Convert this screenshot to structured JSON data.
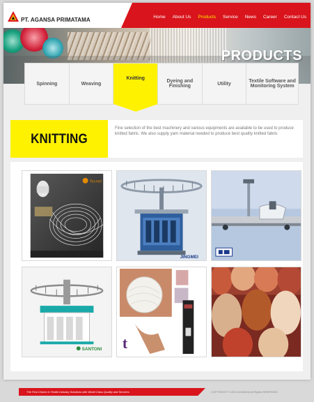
{
  "header": {
    "brand": "PT. AGANSA PRIMATAMA",
    "logo_icon": "triangle-logo-icon",
    "nav": [
      {
        "label": "Home",
        "active": false
      },
      {
        "label": "About Us",
        "active": false
      },
      {
        "label": "Products",
        "active": true
      },
      {
        "label": "Service",
        "active": false
      },
      {
        "label": "News",
        "active": false
      },
      {
        "label": "Career",
        "active": false
      },
      {
        "label": "Contact Us",
        "active": false
      }
    ]
  },
  "banner": {
    "title": "PRODUCTS"
  },
  "tabs": [
    {
      "label": "Spinning",
      "active": false
    },
    {
      "label": "Weaving",
      "active": false
    },
    {
      "label": "Knitting",
      "active": true
    },
    {
      "label": "Dyeing and Finishing",
      "active": false
    },
    {
      "label": "Utility",
      "active": false
    },
    {
      "label": "Textile Software and Monitoring System",
      "active": false
    }
  ],
  "section": {
    "title": "KNITTING",
    "description": "Fine selection of the best machinery and various equipments are available to be used to produce knitted fabric.  We also supply yarn material needed to produce best quality knitted fabric"
  },
  "gallery": [
    {
      "name": "tecnet-yarn-poster",
      "logo_text": "Tecnet"
    },
    {
      "name": "jingmei-circular-knitting-machine",
      "logo_text": "JINGMEI"
    },
    {
      "name": "knitting-inspection-device",
      "logo_text": ""
    },
    {
      "name": "santoni-circular-knitting-machine",
      "logo_text": "SANTONI"
    },
    {
      "name": "yarn-ball-collage",
      "logo_text": "t"
    },
    {
      "name": "colored-yarn-cones",
      "logo_text": ""
    }
  ],
  "footer": {
    "tagline": "The First Choice in Textile Industry Solutions with World Class Quality and Services",
    "copyright": "COPYRIGHT © 2013 AGANSA All Rights RESERVED"
  },
  "colors": {
    "brand_red": "#d9141c",
    "accent_yellow": "#fff200",
    "nav_active": "#ffe600"
  }
}
